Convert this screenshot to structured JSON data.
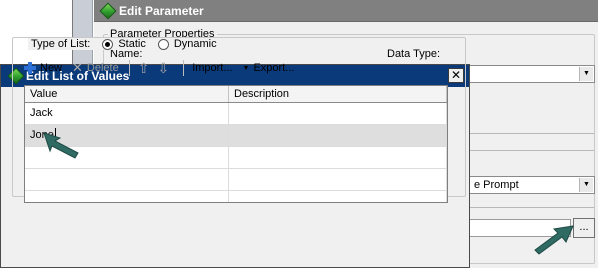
{
  "background_window": {
    "title": "Edit Parameter",
    "group_title": "Parameter Properties",
    "name_label": "Name:",
    "data_type_label": "Data Type:",
    "prompt_combo_value": "e Prompt",
    "ellipsis_label": "..."
  },
  "dialog": {
    "title": "Edit List of Values",
    "close_label": "✕",
    "type_of_list_label": "Type of List:",
    "options": [
      {
        "label": "Static",
        "selected": true
      },
      {
        "label": "Dynamic",
        "selected": false
      }
    ]
  },
  "toolbar": {
    "new_label": "New",
    "delete_label": "Delete",
    "import_label": "Import...",
    "export_label": "Export..."
  },
  "table": {
    "columns": [
      "Value",
      "Description"
    ],
    "rows": [
      {
        "value": "Jack",
        "description": ""
      },
      {
        "value": "Jone",
        "description": ""
      }
    ]
  },
  "colors": {
    "dialog_titlebar": "#0b3a7a",
    "background_titlebar": "#808080",
    "callout_arrow": "#2f6b63",
    "new_plus": "#2e6fd4"
  }
}
